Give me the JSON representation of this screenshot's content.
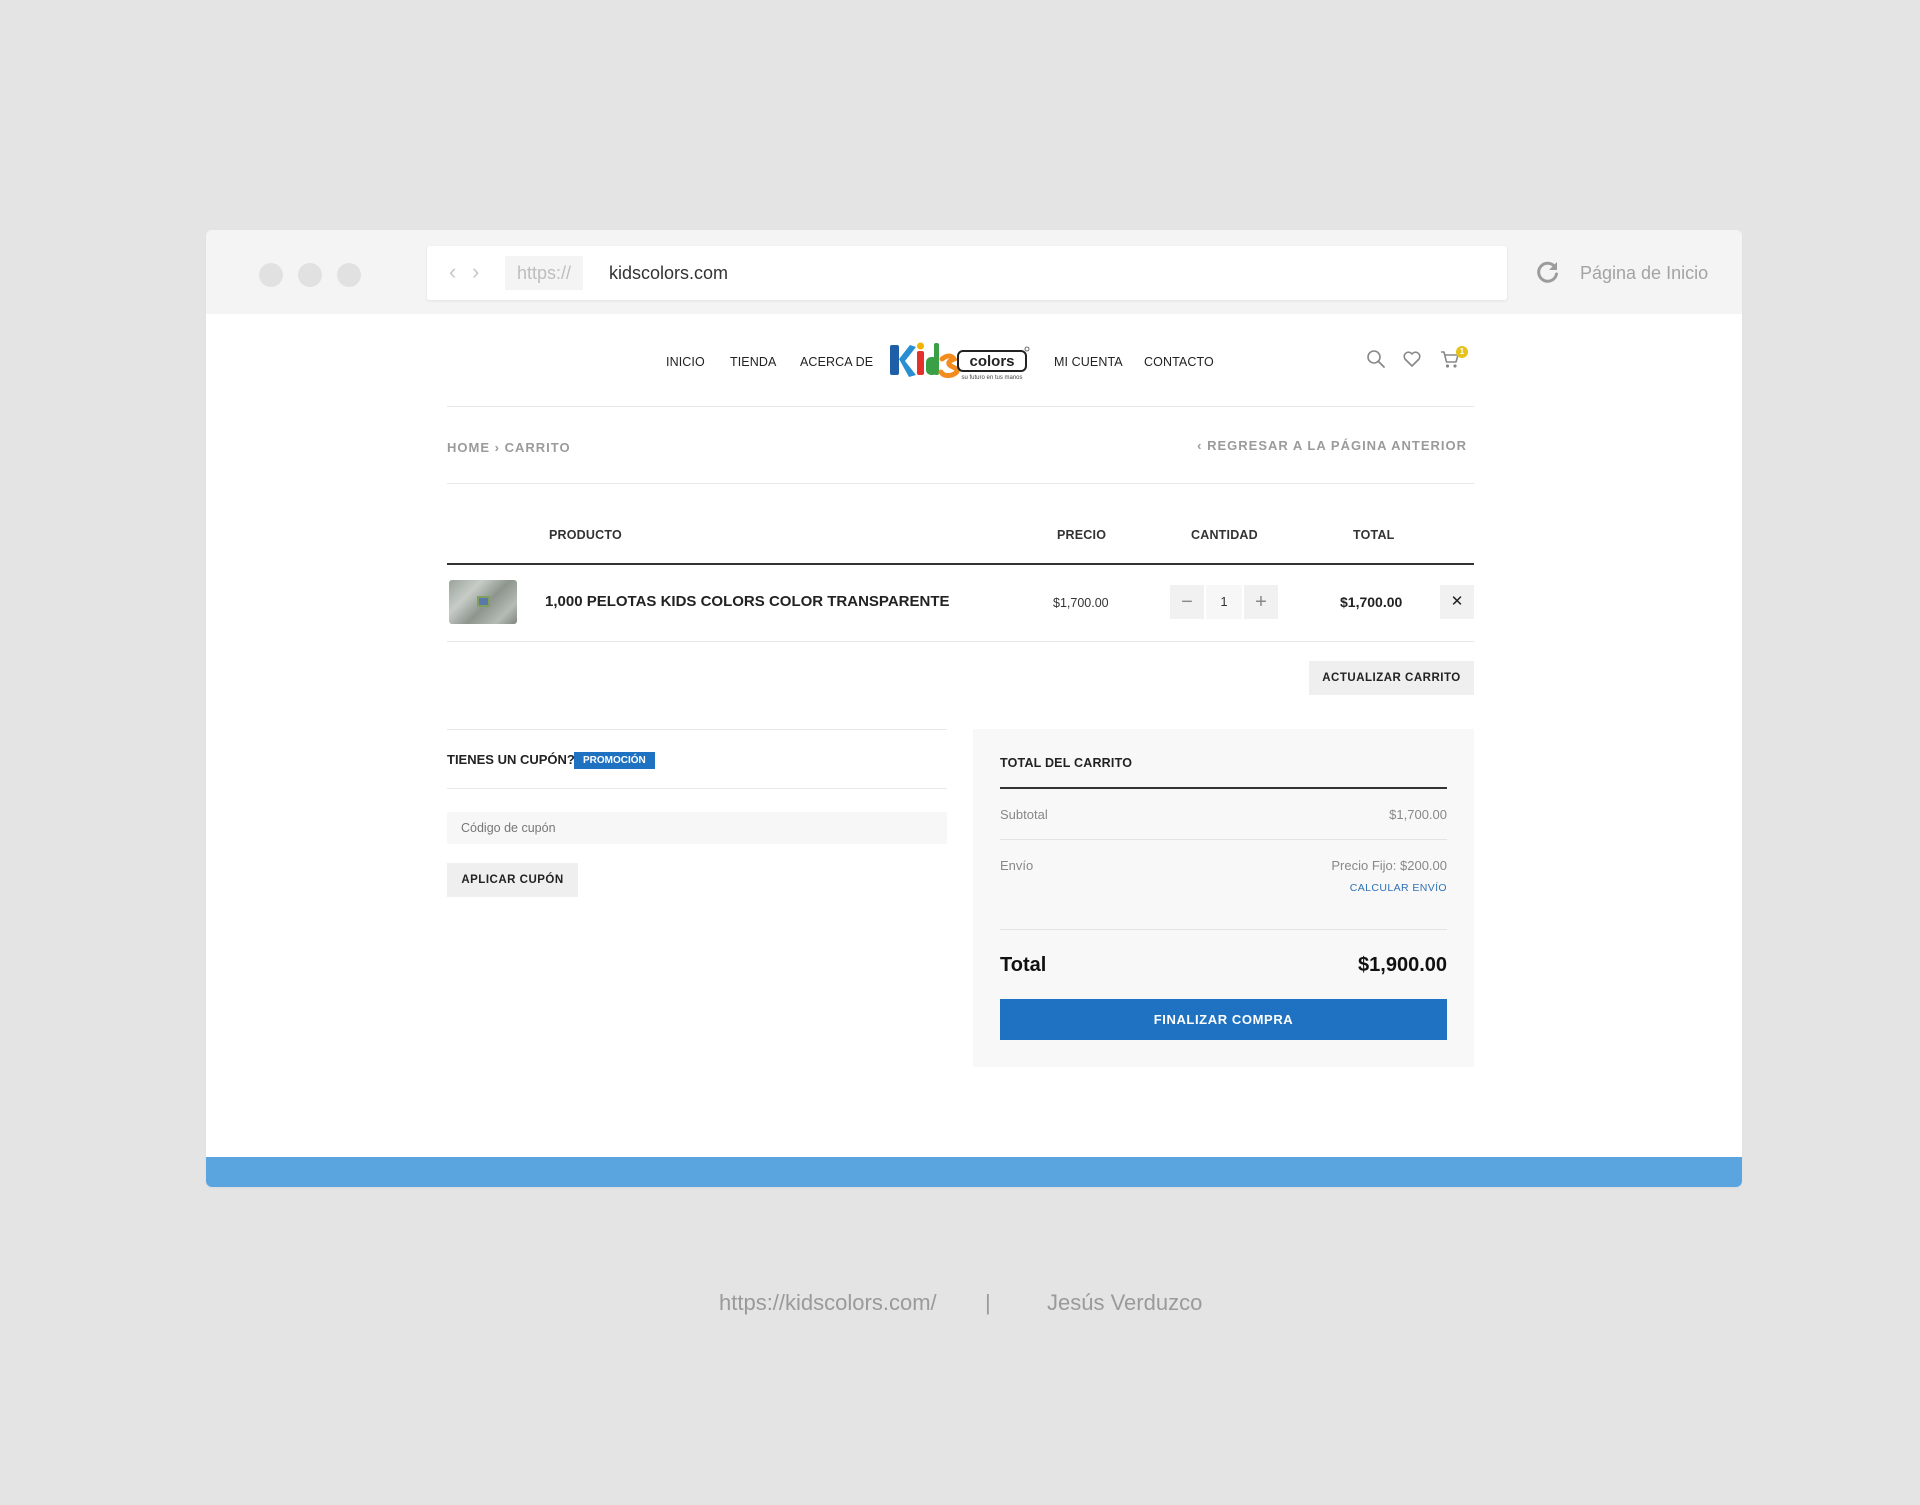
{
  "browser": {
    "protocol": "https://",
    "domain": "kidscolors.com",
    "home_label": "Página de Inicio"
  },
  "nav": {
    "left": [
      "INICIO",
      "TIENDA",
      "ACERCA DE"
    ],
    "right": [
      "MI CUENTA",
      "CONTACTO"
    ],
    "logo_text": "Kids colors",
    "logo_tagline": "su futuro en tus manos",
    "cart_count": "1"
  },
  "breadcrumb": {
    "home": "HOME",
    "separator": "›",
    "current": "CARRITO",
    "back_link": "‹ REGRESAR A LA PÁGINA ANTERIOR"
  },
  "cart_table": {
    "headers": {
      "product": "PRODUCTO",
      "price": "PRECIO",
      "quantity": "CANTIDAD",
      "total": "TOTAL"
    },
    "items": [
      {
        "name": "1,000 PELOTAS KIDS COLORS COLOR TRANSPARENTE",
        "price": "$1,700.00",
        "quantity": "1",
        "total": "$1,700.00"
      }
    ],
    "update_button": "ACTUALIZAR CARRITO"
  },
  "coupon": {
    "title": "TIENES UN CUPÓN?",
    "badge": "PROMOCIÓN",
    "placeholder": "Código de cupón",
    "apply_button": "APLICAR CUPÓN"
  },
  "totals": {
    "title": "TOTAL DEL CARRITO",
    "subtotal_label": "Subtotal",
    "subtotal_value": "$1,700.00",
    "shipping_label": "Envío",
    "shipping_value": "Precio Fijo: $200.00",
    "calculate_shipping": "CALCULAR ENVÍO",
    "total_label": "Total",
    "total_value": "$1,900.00",
    "checkout_button": "FINALIZAR COMPRA"
  },
  "caption": {
    "url": "https://kidscolors.com/",
    "divider": "|",
    "author": "Jesús Verduzco"
  },
  "colors": {
    "page_bg": "#e4e4e4",
    "accent_blue": "#1f72c2",
    "bottom_bar": "#5aa4df",
    "badge_yellow": "#e7c21b"
  }
}
